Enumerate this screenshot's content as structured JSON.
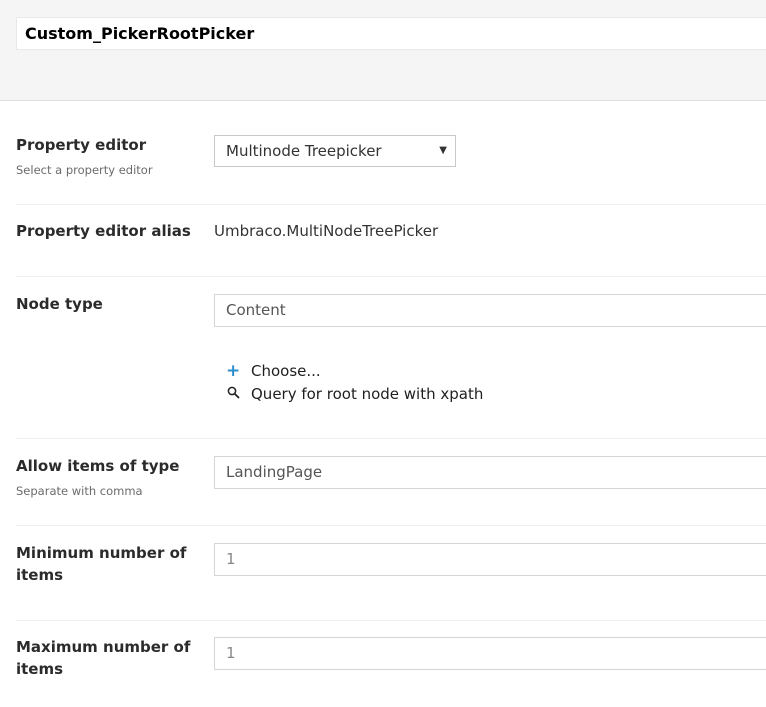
{
  "header": {
    "name_value": "Custom_PickerRootPicker"
  },
  "property_editor": {
    "label": "Property editor",
    "description": "Select a property editor",
    "selected": "Multinode Treepicker",
    "caret": "▼"
  },
  "alias": {
    "label": "Property editor alias",
    "value": "Umbraco.MultiNodeTreePicker"
  },
  "node_type": {
    "label": "Node type",
    "value": "Content",
    "choose_label": "Choose...",
    "query_label": "Query for root node with xpath",
    "choose_icon": "plus-icon",
    "query_icon": "search-icon"
  },
  "allow_items": {
    "label": "Allow items of type",
    "description": "Separate with comma",
    "value": "LandingPage"
  },
  "min_items": {
    "label_line1": "Minimum number of",
    "label_line2": "items",
    "value": "1"
  },
  "max_items": {
    "label_line1": "Maximum number of",
    "label_line2": "items",
    "value": "1"
  },
  "colors": {
    "accent": "#2e8ece",
    "header_bg": "#f5f5f5"
  }
}
